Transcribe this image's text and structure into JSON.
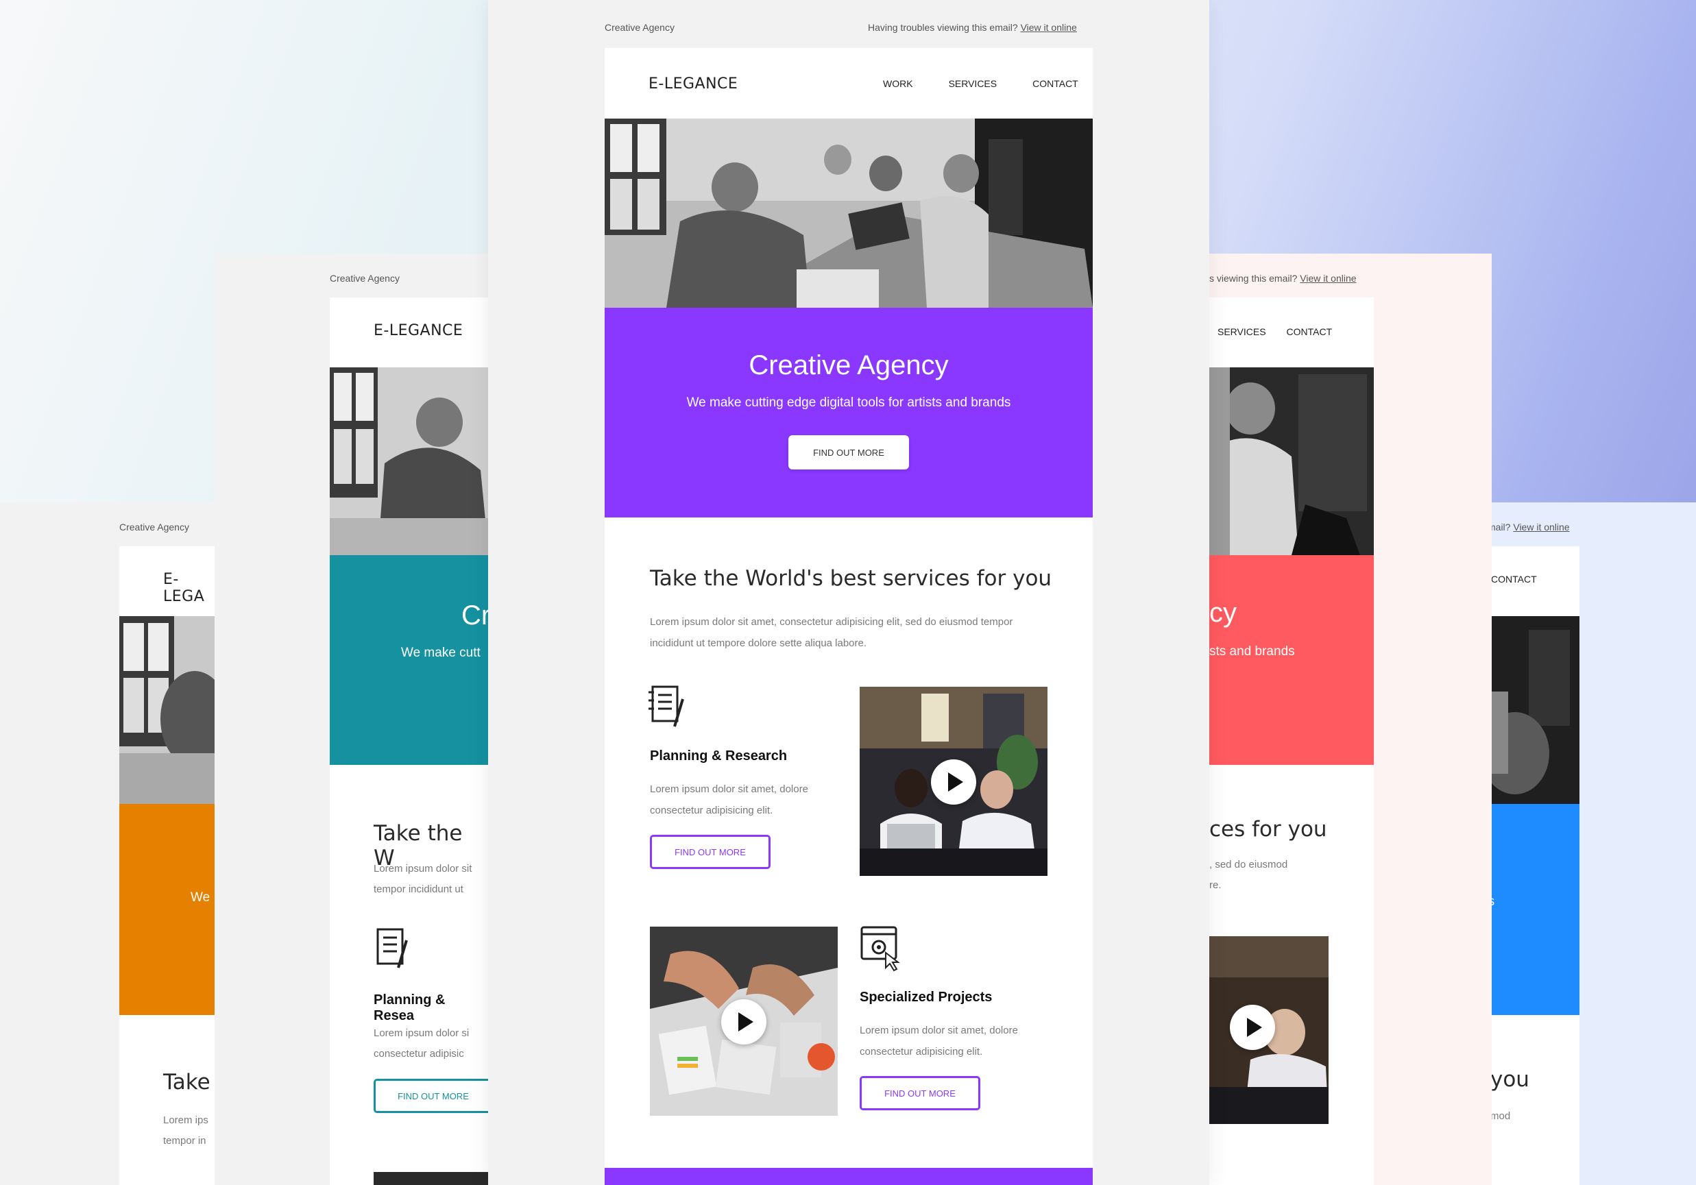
{
  "brand": "E-LEGANCE",
  "preheader": {
    "left": "Creative Agency",
    "trouble": "Having troubles viewing this email?",
    "view_link": "View it online",
    "trouble_partial": "s viewing this email?",
    "trouble_partial_short": "mail?"
  },
  "nav": [
    "WORK",
    "SERVICES",
    "CONTACT"
  ],
  "hero": {
    "title": "Creative Agency",
    "subtitle": "We make cutting edge digital tools for artists and brands",
    "button": "FIND OUT MORE"
  },
  "services": {
    "title": "Take the World's best services for you",
    "body": "Lorem ipsum dolor sit amet, consectetur adipisicing elit, sed do eiusmod tempor incididunt ut tempore dolore sette aliqua labore."
  },
  "features": [
    {
      "icon": "notebook-icon",
      "title": "Planning & Research",
      "body": "Lorem ipsum dolor sit amet, dolore consectetur adipisicing elit.",
      "button": "FIND OUT MORE"
    },
    {
      "icon": "browser-gear-icon",
      "title": "Specialized Projects",
      "body": "Lorem ipsum dolor sit amet, dolore consectetur adipisicing elit.",
      "button": "FIND OUT MORE"
    }
  ],
  "fragments": {
    "teal_title": "Cr",
    "teal_sub": "We make cutt",
    "teal_services_title": "Take the W",
    "teal_body_1": "Lorem ipsum dolor sit",
    "teal_body_2": "tempor incididunt ut",
    "teal_feat_title": "Planning & Resea",
    "teal_feat_body_1": "Lorem ipsum dolor si",
    "teal_feat_body_2": "consectetur adipisic",
    "orange_logo": "E-LEGA",
    "orange_sub": "We",
    "orange_services_title": "Take",
    "orange_body_1": "Lorem ips",
    "orange_body_2": "tempor in",
    "coral_title": "cy",
    "coral_sub": "sts and brands",
    "coral_services_title": "ces for you",
    "coral_body_1": ", sed do eiusmod",
    "coral_body_2": "re.",
    "blue_sub": "ds",
    "blue_services_title": "you",
    "blue_body": "mod"
  },
  "colors": {
    "purple": "#8a37ff",
    "teal": "#1591a0",
    "orange": "#e58000",
    "coral": "#ff5a5f",
    "blue": "#1e8cff"
  }
}
